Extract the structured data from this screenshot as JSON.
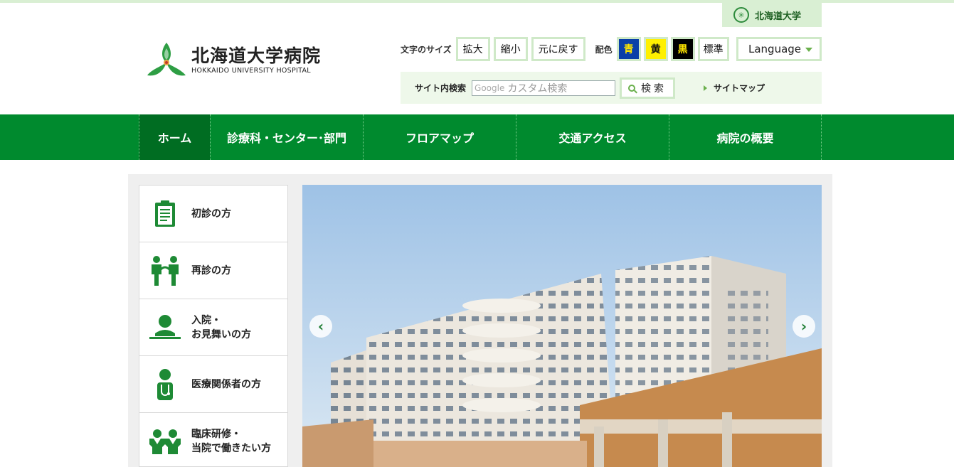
{
  "university_link": "北海道大学",
  "logo": {
    "name_jp": "北海道大学病院",
    "name_en": "HOKKAIDO UNIVERSITY HOSPITAL"
  },
  "font_size": {
    "label": "文字のサイズ",
    "buttons": [
      "拡大",
      "縮小",
      "元に戻す"
    ]
  },
  "color_scheme": {
    "label": "配色",
    "options": [
      {
        "label": "青",
        "bg": "#0a3fa8",
        "fg": "#ffe600"
      },
      {
        "label": "黄",
        "bg": "#fff000",
        "fg": "#111111"
      },
      {
        "label": "黒",
        "bg": "#000000",
        "fg": "#ffe600"
      },
      {
        "label": "標準",
        "bg": "#ffffff",
        "fg": "#111111"
      }
    ]
  },
  "language": {
    "label": "Language"
  },
  "search": {
    "label": "サイト内検索",
    "brand": "Google",
    "placeholder": "カスタム検索",
    "button": "検索"
  },
  "sitemap": "サイトマップ",
  "nav": [
    "ホーム",
    "診療科・センター･部門",
    "フロアマップ",
    "交通アクセス",
    "病院の概要"
  ],
  "sidebar": [
    {
      "line1": "初診の方",
      "line2": "",
      "icon": "clipboard-icon"
    },
    {
      "line1": "再診の方",
      "line2": "",
      "icon": "doctor-patient-icon"
    },
    {
      "line1": "入院・",
      "line2": "お見舞いの方",
      "icon": "person-bed-icon"
    },
    {
      "line1": "医療関係者の方",
      "line2": "",
      "icon": "medical-staff-icon"
    },
    {
      "line1": "臨床研修・",
      "line2": "当院で働きたい方",
      "icon": "two-people-icon"
    }
  ],
  "colors": {
    "brand_green": "#008a2e",
    "light_green": "#d9efd3"
  }
}
